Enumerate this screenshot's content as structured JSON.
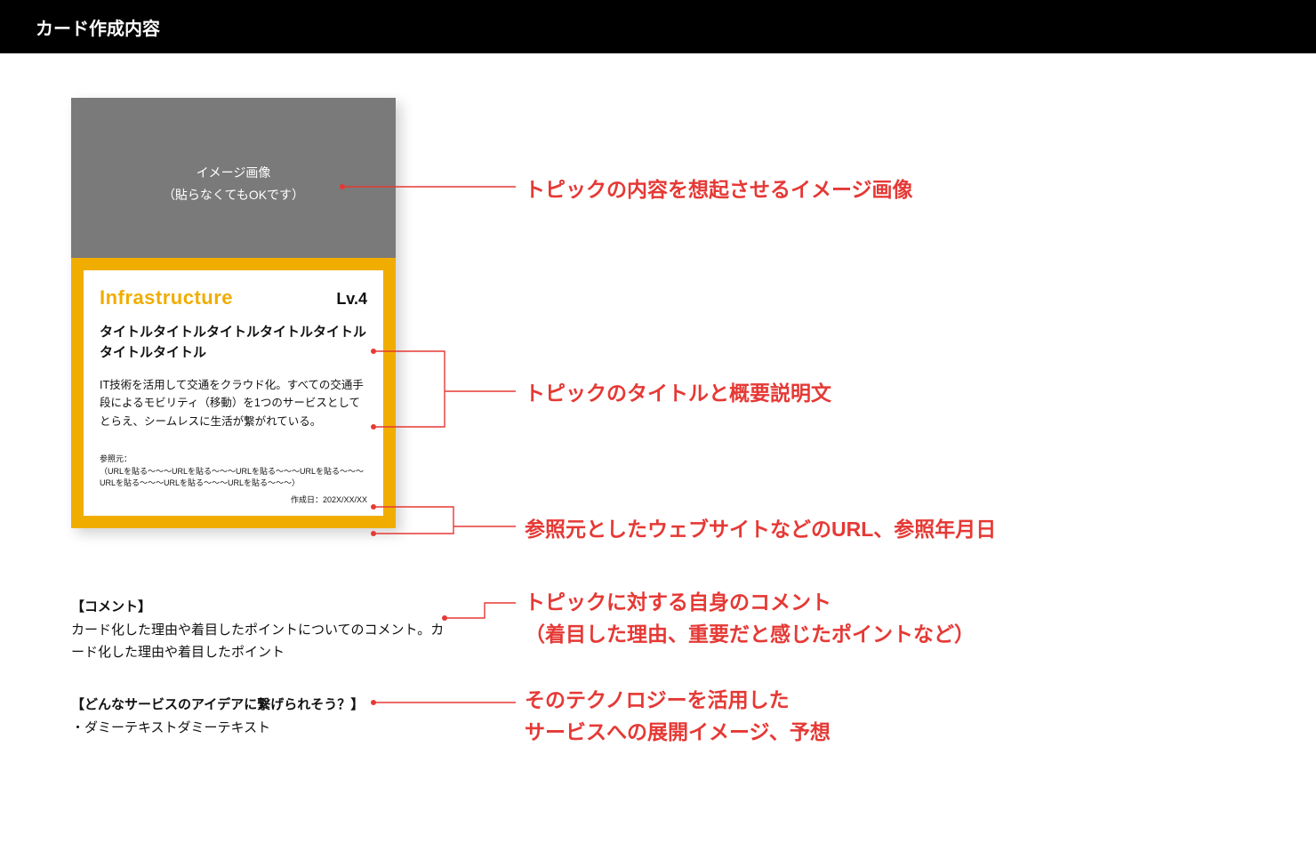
{
  "header": {
    "title": "カード作成内容"
  },
  "card": {
    "image_placeholder_line1": "イメージ画像",
    "image_placeholder_line2": "（貼らなくてもOKです）",
    "category": "Infrastructure",
    "level": "Lv.4",
    "title": "タイトルタイトルタイトルタイトルタイトルタイトルタイトル",
    "description": "IT技術を活用して交通をクラウド化。すべての交通手段によるモビリティ（移動）を1つのサービスとしてとらえ、シームレスに生活が繋がれている。",
    "reference_label": "参照元：",
    "reference_body": "（URLを貼る〜〜〜URLを貼る〜〜〜URLを貼る〜〜〜URLを貼る〜〜〜URLを貼る〜〜〜URLを貼る〜〜〜URLを貼る〜〜〜）",
    "created_label": "作成日：202X/XX/XX"
  },
  "notes": {
    "comment_heading": "【コメント】",
    "comment_body": "カード化した理由や着目したポイントについてのコメント。カード化した理由や着目したポイント",
    "idea_heading": "【どんなサービスのアイデアに繋げられそう？】",
    "idea_body": "・ダミーテキストダミーテキスト"
  },
  "annotations": {
    "a1": "トピックの内容を想起させるイメージ画像",
    "a2": "トピックのタイトルと概要説明文",
    "a3": "参照元としたウェブサイトなどのURL、参照年月日",
    "a4_line1": "トピックに対する自身のコメント",
    "a4_line2": "（着目した理由、重要だと感じたポイントなど）",
    "a5_line1": "そのテクノロジーを活用した",
    "a5_line2": "サービスへの展開イメージ、予想"
  },
  "colors": {
    "accent_yellow": "#f0ad00",
    "annotation_red": "#e53935",
    "image_gray": "#7a7a7a"
  }
}
